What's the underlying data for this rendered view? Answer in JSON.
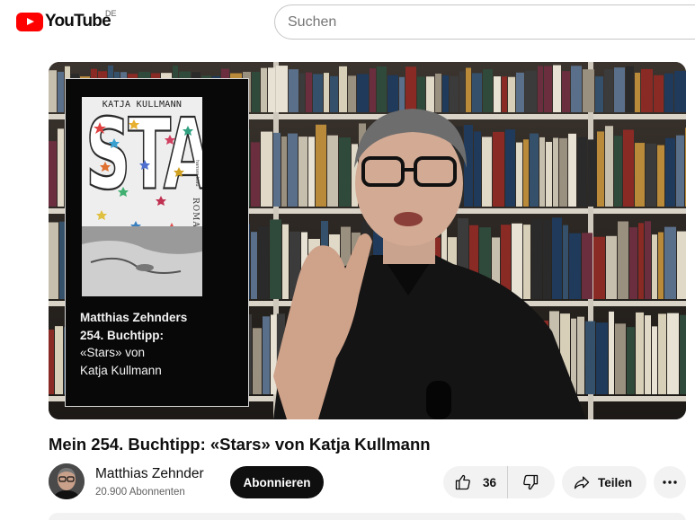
{
  "header": {
    "logo_text": "YouTube",
    "country_code": "DE",
    "search_placeholder": "Suchen"
  },
  "player": {
    "overlay": {
      "book_author": "KATJA KULLMANN",
      "book_title": "STARS",
      "book_subtitle": "ROMAN",
      "book_publisher": "hanser blau",
      "line1": "Matthias Zehnders",
      "line2": "254. Buchtipp:",
      "line3": "«Stars» von",
      "line4": "Katja Kullmann"
    },
    "icons": [
      "picture-in-picture-icon"
    ]
  },
  "video": {
    "title": "Mein 254. Buchtipp: «Stars» von Katja Kullmann"
  },
  "channel": {
    "name": "Matthias Zehnder",
    "subscribers": "20.900 Abonnenten",
    "subscribe_label": "Abonnieren"
  },
  "actions": {
    "like_count": "36",
    "share_label": "Teilen",
    "icons": [
      "thumbs-up-icon",
      "thumbs-down-icon",
      "share-icon",
      "more-icon"
    ]
  },
  "colors": {
    "brand_red": "#ff0000",
    "button_dark": "#0f0f0f",
    "chip_bg": "#f2f2f2"
  }
}
